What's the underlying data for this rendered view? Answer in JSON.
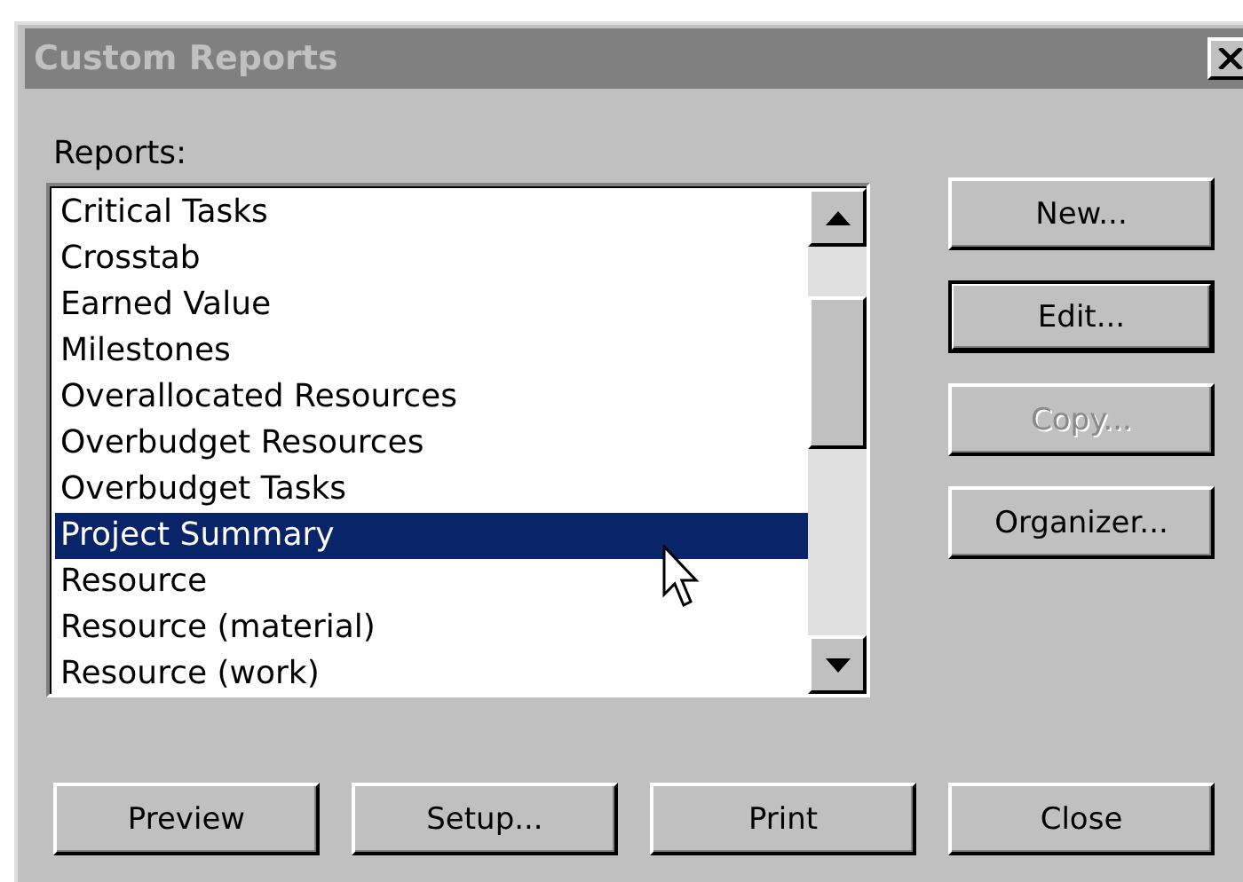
{
  "window": {
    "title": "Custom Reports",
    "active": false
  },
  "reports_label": "Reports:",
  "reports": [
    {
      "label": "Critical Tasks",
      "selected": false
    },
    {
      "label": "Crosstab",
      "selected": false
    },
    {
      "label": "Earned Value",
      "selected": false
    },
    {
      "label": "Milestones",
      "selected": false
    },
    {
      "label": "Overallocated Resources",
      "selected": false
    },
    {
      "label": "Overbudget Resources",
      "selected": false
    },
    {
      "label": "Overbudget Tasks",
      "selected": false
    },
    {
      "label": "Project Summary",
      "selected": true
    },
    {
      "label": "Resource",
      "selected": false
    },
    {
      "label": "Resource (material)",
      "selected": false
    },
    {
      "label": "Resource (work)",
      "selected": false
    }
  ],
  "side_buttons": [
    {
      "label": "New...",
      "disabled": false,
      "default": false
    },
    {
      "label": "Edit...",
      "disabled": false,
      "default": true
    },
    {
      "label": "Copy...",
      "disabled": true,
      "default": false
    },
    {
      "label": "Organizer...",
      "disabled": false,
      "default": false
    }
  ],
  "bottom_buttons": [
    {
      "label": "Preview",
      "disabled": false,
      "default": false
    },
    {
      "label": "Setup...",
      "disabled": false,
      "default": false
    },
    {
      "label": "Print",
      "disabled": false,
      "default": false
    },
    {
      "label": "Close",
      "disabled": false,
      "default": false
    }
  ]
}
